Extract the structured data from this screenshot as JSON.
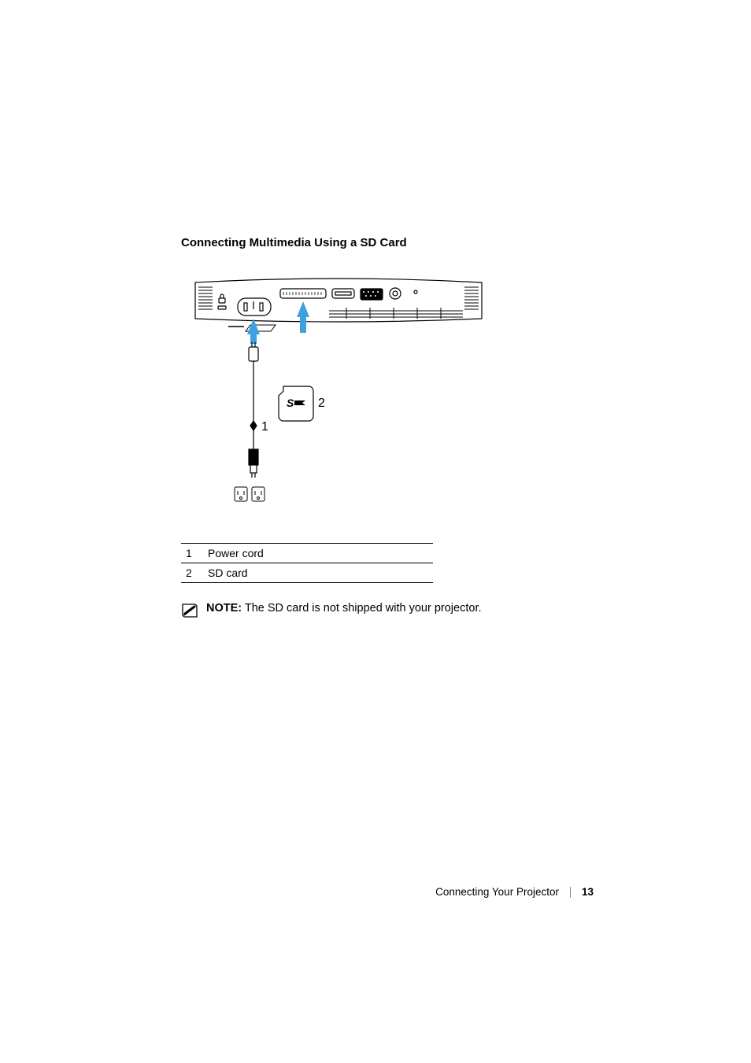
{
  "heading": "Connecting Multimedia Using a SD Card",
  "diagram": {
    "callouts": {
      "one": "1",
      "two": "2"
    }
  },
  "legend": [
    {
      "num": "1",
      "label": "Power cord"
    },
    {
      "num": "2",
      "label": "SD card"
    }
  ],
  "note": {
    "label": "NOTE:",
    "body": " The SD card is not shipped with your projector."
  },
  "footer": {
    "section": "Connecting Your Projector",
    "page": "13"
  }
}
